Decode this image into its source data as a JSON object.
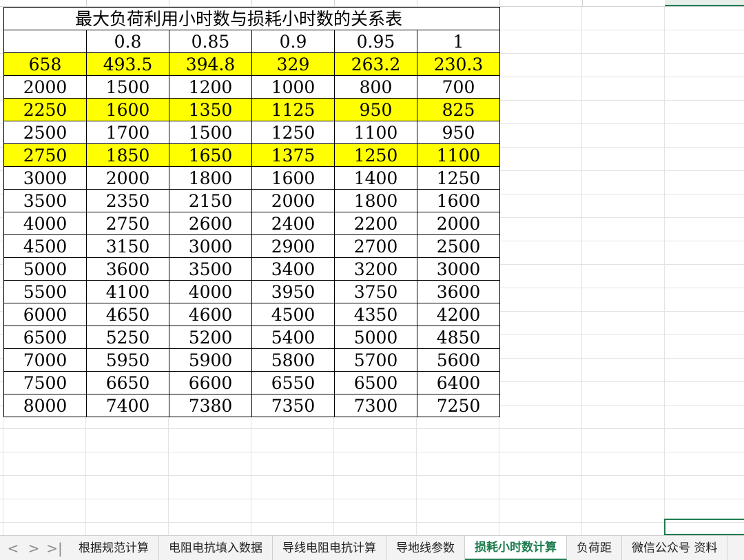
{
  "table": {
    "title": "最大负荷利用小时数与损耗小时数的关系表",
    "header": [
      "",
      "0.8",
      "0.85",
      "0.9",
      "0.95",
      "1"
    ],
    "rows": [
      [
        "658",
        "493.5",
        "394.8",
        "329",
        "263.2",
        "230.3"
      ],
      [
        "2000",
        "1500",
        "1200",
        "1000",
        "800",
        "700"
      ],
      [
        "2250",
        "1600",
        "1350",
        "1125",
        "950",
        "825"
      ],
      [
        "2500",
        "1700",
        "1500",
        "1250",
        "1100",
        "950"
      ],
      [
        "2750",
        "1850",
        "1650",
        "1375",
        "1250",
        "1100"
      ],
      [
        "3000",
        "2000",
        "1800",
        "1600",
        "1400",
        "1250"
      ],
      [
        "3500",
        "2350",
        "2150",
        "2000",
        "1800",
        "1600"
      ],
      [
        "4000",
        "2750",
        "2600",
        "2400",
        "2200",
        "2000"
      ],
      [
        "4500",
        "3150",
        "3000",
        "2900",
        "2700",
        "2500"
      ],
      [
        "5000",
        "3600",
        "3500",
        "3400",
        "3200",
        "3000"
      ],
      [
        "5500",
        "4100",
        "4000",
        "3950",
        "3750",
        "3600"
      ],
      [
        "6000",
        "4650",
        "4600",
        "4500",
        "4350",
        "4200"
      ],
      [
        "6500",
        "5250",
        "5200",
        "5400",
        "5000",
        "4850"
      ],
      [
        "7000",
        "5950",
        "5900",
        "5800",
        "5700",
        "5600"
      ],
      [
        "7500",
        "6650",
        "6600",
        "6550",
        "6500",
        "6400"
      ],
      [
        "8000",
        "7400",
        "7380",
        "7350",
        "7300",
        "7250"
      ]
    ],
    "highlight_rows": [
      0,
      2,
      4
    ],
    "highlight_color": "#ffff00"
  },
  "tabs": {
    "nav": [
      "<",
      ">",
      ">|"
    ],
    "items": [
      "根据规范计算",
      "电阻电抗填入数据",
      "导线电阻电抗计算",
      "导地线参数",
      "损耗小时数计算",
      "负荷距",
      "微信公众号 资料"
    ],
    "active_index": 4
  },
  "accent_color": "#1e7c4f"
}
